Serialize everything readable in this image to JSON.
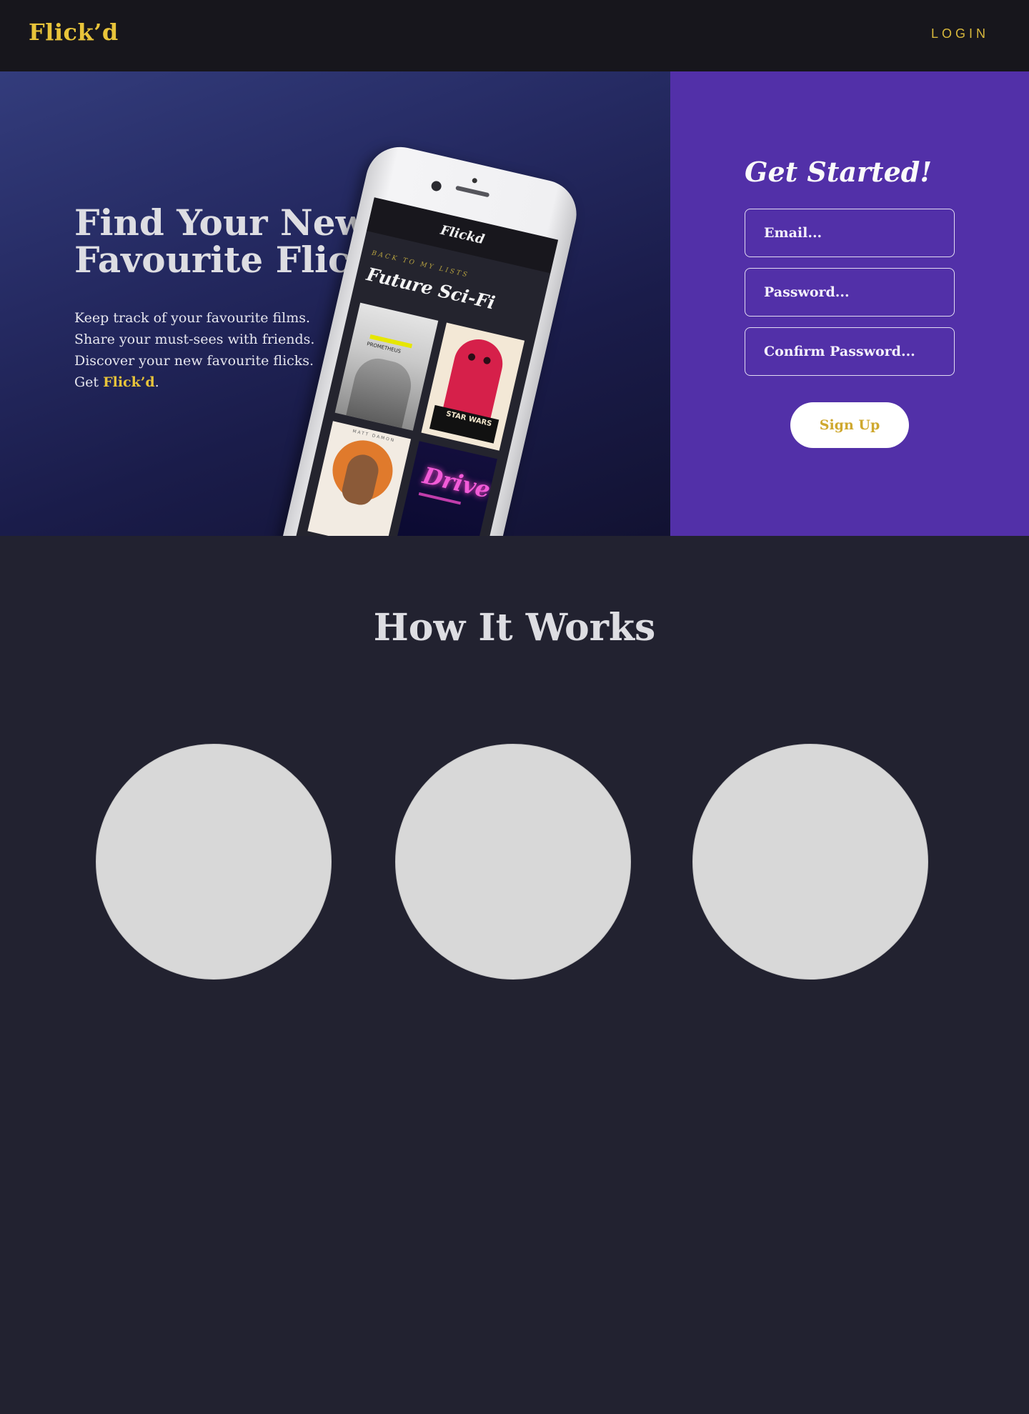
{
  "nav": {
    "logo": "Flick’d",
    "login_label": "LOGIN"
  },
  "hero": {
    "title": "Find Your New Favourite Flick.",
    "lines": [
      "Keep track of your favourite films.",
      "Share your must-sees with friends.",
      "Discover your new favourite flicks."
    ],
    "cta_prefix": "Get ",
    "cta_brand": "Flick’d",
    "cta_suffix": "."
  },
  "phone": {
    "app_name": "Flickd",
    "back_link": "BACK TO MY LISTS",
    "list_title": "Future Sci-Fi",
    "posters": [
      {
        "title": "PROMETHEUS"
      },
      {
        "title": "STAR WARS"
      },
      {
        "title": "MATT DAMON"
      },
      {
        "title": "Drive"
      }
    ]
  },
  "signup": {
    "title": "Get Started!",
    "email_placeholder": "Email...",
    "password_placeholder": "Password...",
    "confirm_placeholder": "Confirm Password...",
    "button_label": "Sign Up"
  },
  "how": {
    "title": "How It Works"
  },
  "colors": {
    "brand_yellow": "#e8c43a",
    "panel_purple": "#5230a8",
    "page_bg": "#222230",
    "nav_bg": "#17161c"
  }
}
